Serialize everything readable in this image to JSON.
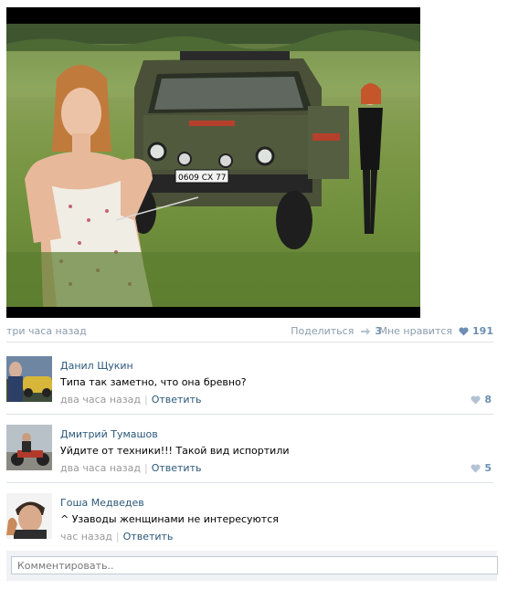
{
  "post": {
    "time": "три часа назад",
    "share_label": "Поделиться",
    "share_count": "3",
    "like_label": "Мне нравится",
    "like_count": "191",
    "photo_plate": "0609 СХ 77"
  },
  "comments": [
    {
      "author": "Данил Щукин",
      "text": "Типа так заметно, что она бревно?",
      "time": "два часа назад",
      "reply": "Ответить",
      "likes": "8"
    },
    {
      "author": "Дмитрий Тумашов",
      "text": "Уйдите от техники!!! Такой вид испортили",
      "time": "два часа назад",
      "reply": "Ответить",
      "likes": "5"
    },
    {
      "author": "Гоша Медведев",
      "text": "^ Узаводы женщинами не интересуются",
      "time": "час назад",
      "reply": "Ответить",
      "likes": ""
    }
  ],
  "comment_input": {
    "placeholder": "Комментировать.."
  },
  "colors": {
    "link": "#2b587a",
    "muted": "#8a9cad",
    "accent": "#6d8fb3",
    "separator": "#dee3ea"
  },
  "icons": [
    "share-icon",
    "heart-icon"
  ]
}
